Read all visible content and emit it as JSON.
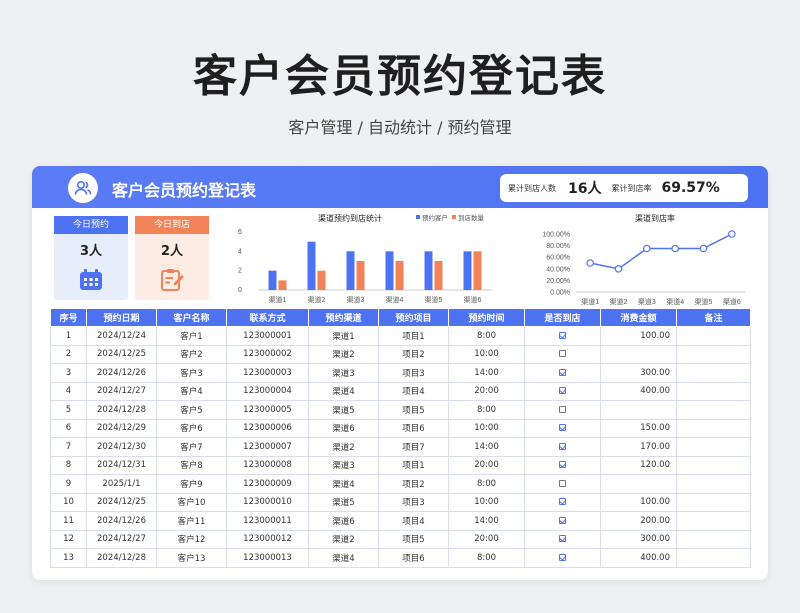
{
  "page": {
    "title": "客户会员预约登记表",
    "subtitle": "客户管理 / 自动统计 / 预约管理"
  },
  "card": {
    "title": "客户会员预约登记表",
    "summary": {
      "total_label": "累计到店人数",
      "total_value": "16人",
      "rate_label": "累计到店率",
      "rate_value": "69.57%"
    }
  },
  "kpis": {
    "today_booking_label": "今日预约",
    "today_booking_value": "3人",
    "today_arrival_label": "今日到店",
    "today_arrival_value": "2人"
  },
  "colors": {
    "accent": "#4e73f2",
    "orange": "#f28257"
  },
  "chart_data": [
    {
      "type": "bar",
      "title": "渠道预约到店统计",
      "categories": [
        "渠道1",
        "渠道2",
        "渠道3",
        "渠道4",
        "渠道5",
        "渠道6"
      ],
      "series": [
        {
          "name": "预约客户",
          "values": [
            2,
            5,
            4,
            4,
            4,
            4
          ]
        },
        {
          "name": "到店数量",
          "values": [
            1,
            2,
            3,
            3,
            3,
            4
          ]
        }
      ],
      "ylim": [
        0,
        6
      ],
      "yticks": [
        0,
        2,
        4,
        6
      ],
      "legend": "top-right"
    },
    {
      "type": "line",
      "title": "渠道到店率",
      "categories": [
        "渠道1",
        "渠道2",
        "渠道3",
        "渠道4",
        "渠道5",
        "渠道6"
      ],
      "values": [
        0.5,
        0.4,
        0.75,
        0.75,
        0.75,
        1.0
      ],
      "ylim": [
        0,
        1
      ],
      "yticks": [
        "0.00%",
        "20.00%",
        "40.00%",
        "60.00%",
        "80.00%",
        "100.00%"
      ]
    }
  ],
  "table": {
    "headers": [
      "序号",
      "预约日期",
      "客户名称",
      "联系方式",
      "预约渠道",
      "预约项目",
      "预约时间",
      "是否到店",
      "消费金额",
      "备注"
    ],
    "rows": [
      {
        "no": "1",
        "date": "2024/12/24",
        "name": "客户1",
        "phone": "123000001",
        "channel": "渠道1",
        "item": "项目1",
        "time": "8:00",
        "arrived": true,
        "amount": "100.00",
        "note": ""
      },
      {
        "no": "2",
        "date": "2024/12/25",
        "name": "客户2",
        "phone": "123000002",
        "channel": "渠道2",
        "item": "项目2",
        "time": "10:00",
        "arrived": false,
        "amount": "",
        "note": ""
      },
      {
        "no": "3",
        "date": "2024/12/26",
        "name": "客户3",
        "phone": "123000003",
        "channel": "渠道3",
        "item": "项目3",
        "time": "14:00",
        "arrived": true,
        "amount": "300.00",
        "note": ""
      },
      {
        "no": "4",
        "date": "2024/12/27",
        "name": "客户4",
        "phone": "123000004",
        "channel": "渠道4",
        "item": "项目4",
        "time": "20:00",
        "arrived": true,
        "amount": "400.00",
        "note": ""
      },
      {
        "no": "5",
        "date": "2024/12/28",
        "name": "客户5",
        "phone": "123000005",
        "channel": "渠道5",
        "item": "项目5",
        "time": "8:00",
        "arrived": false,
        "amount": "",
        "note": ""
      },
      {
        "no": "6",
        "date": "2024/12/29",
        "name": "客户6",
        "phone": "123000006",
        "channel": "渠道6",
        "item": "项目6",
        "time": "10:00",
        "arrived": true,
        "amount": "150.00",
        "note": ""
      },
      {
        "no": "7",
        "date": "2024/12/30",
        "name": "客户7",
        "phone": "123000007",
        "channel": "渠道2",
        "item": "项目7",
        "time": "14:00",
        "arrived": true,
        "amount": "170.00",
        "note": ""
      },
      {
        "no": "8",
        "date": "2024/12/31",
        "name": "客户8",
        "phone": "123000008",
        "channel": "渠道3",
        "item": "项目1",
        "time": "20:00",
        "arrived": true,
        "amount": "120.00",
        "note": ""
      },
      {
        "no": "9",
        "date": "2025/1/1",
        "name": "客户9",
        "phone": "123000009",
        "channel": "渠道4",
        "item": "项目2",
        "time": "8:00",
        "arrived": false,
        "amount": "",
        "note": ""
      },
      {
        "no": "10",
        "date": "2024/12/25",
        "name": "客户10",
        "phone": "123000010",
        "channel": "渠道5",
        "item": "项目3",
        "time": "10:00",
        "arrived": true,
        "amount": "100.00",
        "note": ""
      },
      {
        "no": "11",
        "date": "2024/12/26",
        "name": "客户11",
        "phone": "123000011",
        "channel": "渠道6",
        "item": "项目4",
        "time": "14:00",
        "arrived": true,
        "amount": "200.00",
        "note": ""
      },
      {
        "no": "12",
        "date": "2024/12/27",
        "name": "客户12",
        "phone": "123000012",
        "channel": "渠道2",
        "item": "项目5",
        "time": "20:00",
        "arrived": true,
        "amount": "300.00",
        "note": ""
      },
      {
        "no": "13",
        "date": "2024/12/28",
        "name": "客户13",
        "phone": "123000013",
        "channel": "渠道4",
        "item": "项目6",
        "time": "8:00",
        "arrived": true,
        "amount": "400.00",
        "note": ""
      }
    ]
  }
}
